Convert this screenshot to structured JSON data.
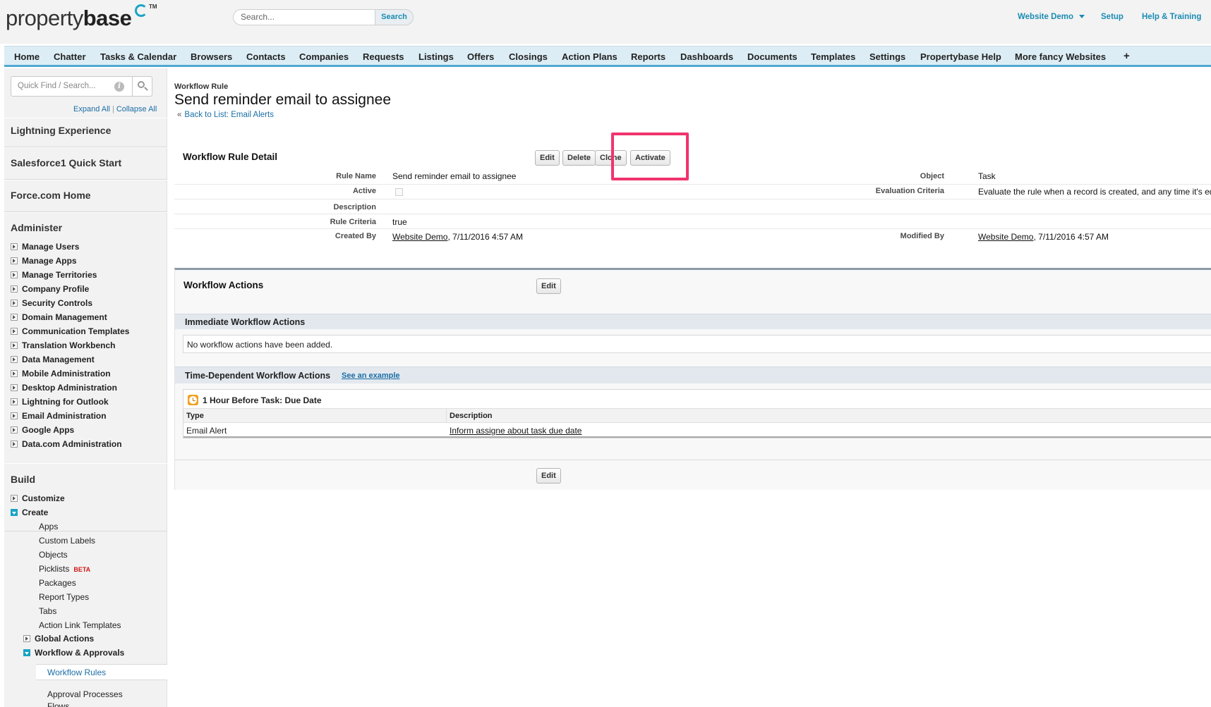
{
  "header": {
    "logo_light": "property",
    "logo_bold": "base",
    "logo_tm": "TM",
    "search_placeholder": "Search...",
    "search_button": "Search",
    "user_menu": "Website Demo",
    "setup": "Setup",
    "help": "Help & Training"
  },
  "tabs": [
    "Home",
    "Chatter",
    "Tasks & Calendar",
    "Browsers",
    "Contacts",
    "Companies",
    "Requests",
    "Listings",
    "Offers",
    "Closings",
    "Action Plans",
    "Reports",
    "Dashboards",
    "Documents",
    "Templates",
    "Settings",
    "Propertybase Help",
    "More fancy Websites",
    "+"
  ],
  "sidebar": {
    "quick_find_placeholder": "Quick Find / Search...",
    "expand_all": "Expand All",
    "separator": "|",
    "collapse_all": "Collapse All",
    "sections": [
      "Lightning Experience",
      "Salesforce1 Quick Start",
      "Force.com Home"
    ],
    "administer_title": "Administer",
    "administer_items": [
      "Manage Users",
      "Manage Apps",
      "Manage Territories",
      "Company Profile",
      "Security Controls",
      "Domain Management",
      "Communication Templates",
      "Translation Workbench",
      "Data Management",
      "Mobile Administration",
      "Desktop Administration",
      "Lightning for Outlook",
      "Email Administration",
      "Google Apps",
      "Data.com Administration"
    ],
    "build_title": "Build",
    "customize": "Customize",
    "create": "Create",
    "create_items": [
      "Apps",
      "Custom Labels",
      "Objects",
      "Picklists",
      "Packages",
      "Report Types",
      "Tabs",
      "Action Link Templates"
    ],
    "beta": "BETA",
    "global_actions": "Global Actions",
    "workflow_approvals": "Workflow & Approvals",
    "workflow_rules": "Workflow Rules",
    "approval_processes": "Approval Processes",
    "flows": "Flows"
  },
  "main": {
    "crumb": "Workflow Rule",
    "title": "Send reminder email to assignee",
    "back_arrow": "«",
    "back_link": "Back to List: Email Alerts",
    "detail_title": "Workflow Rule Detail",
    "buttons": {
      "edit": "Edit",
      "delete": "Delete",
      "clone": "Clone",
      "activate": "Activate"
    },
    "fields": {
      "rule_name_label": "Rule Name",
      "rule_name": "Send reminder email to assignee",
      "active_label": "Active",
      "description_label": "Description",
      "rule_criteria_label": "Rule Criteria",
      "rule_criteria": "true",
      "created_by_label": "Created By",
      "created_by_user": "Website Demo",
      "created_by_date": ", 7/11/2016 4:57 AM",
      "object_label": "Object",
      "object": "Task",
      "eval_label": "Evaluation Criteria",
      "eval": "Evaluate the rule when a record is created, and any time it's edited",
      "modified_by_label": "Modified By",
      "modified_by_user": "Website Demo",
      "modified_by_date": ", 7/11/2016 4:57 AM"
    },
    "actions_title": "Workflow Actions",
    "edit": "Edit",
    "immediate_title": "Immediate Workflow Actions",
    "no_actions": "No workflow actions have been added.",
    "time_dep_title": "Time-Dependent Workflow Actions",
    "see_example": "See an example",
    "trigger_title": "1 Hour Before Task: Due Date",
    "col_type": "Type",
    "col_description": "Description",
    "row_type": "Email Alert",
    "row_description": "Inform assigne about task due date"
  }
}
